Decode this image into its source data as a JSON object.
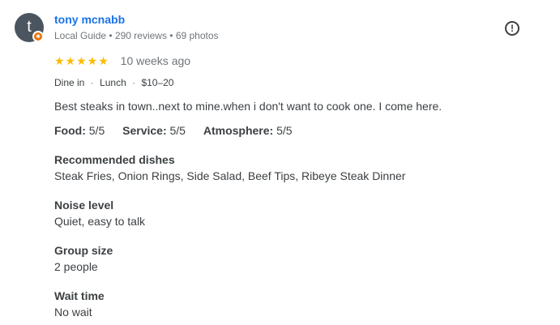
{
  "reviewer": {
    "initial": "t",
    "name": "tony mcnabb",
    "meta": "Local Guide • 290 reviews • 69 photos",
    "badge_glyph": "✷"
  },
  "report_glyph": "!",
  "rating": {
    "stars": "★★★★★",
    "value": 5,
    "date": "10 weeks ago"
  },
  "visit": {
    "service": "Dine in",
    "meal": "Lunch",
    "price": "$10–20",
    "separator": "·"
  },
  "review_text": "Best steaks in town..next to mine.when i don't want to cook one. I come here.",
  "scores": [
    {
      "label": "Food:",
      "value": "5/5"
    },
    {
      "label": "Service:",
      "value": "5/5"
    },
    {
      "label": "Atmosphere:",
      "value": "5/5"
    }
  ],
  "details": [
    {
      "label": "Recommended dishes",
      "value": "Steak Fries, Onion Rings, Side Salad, Beef Tips, Ribeye Steak Dinner"
    },
    {
      "label": "Noise level",
      "value": "Quiet, easy to talk"
    },
    {
      "label": "Group size",
      "value": "2 people"
    },
    {
      "label": "Wait time",
      "value": "No wait"
    }
  ],
  "colors": {
    "link": "#1a73e8",
    "star": "#fbbc04",
    "badge": "#e8710a"
  }
}
